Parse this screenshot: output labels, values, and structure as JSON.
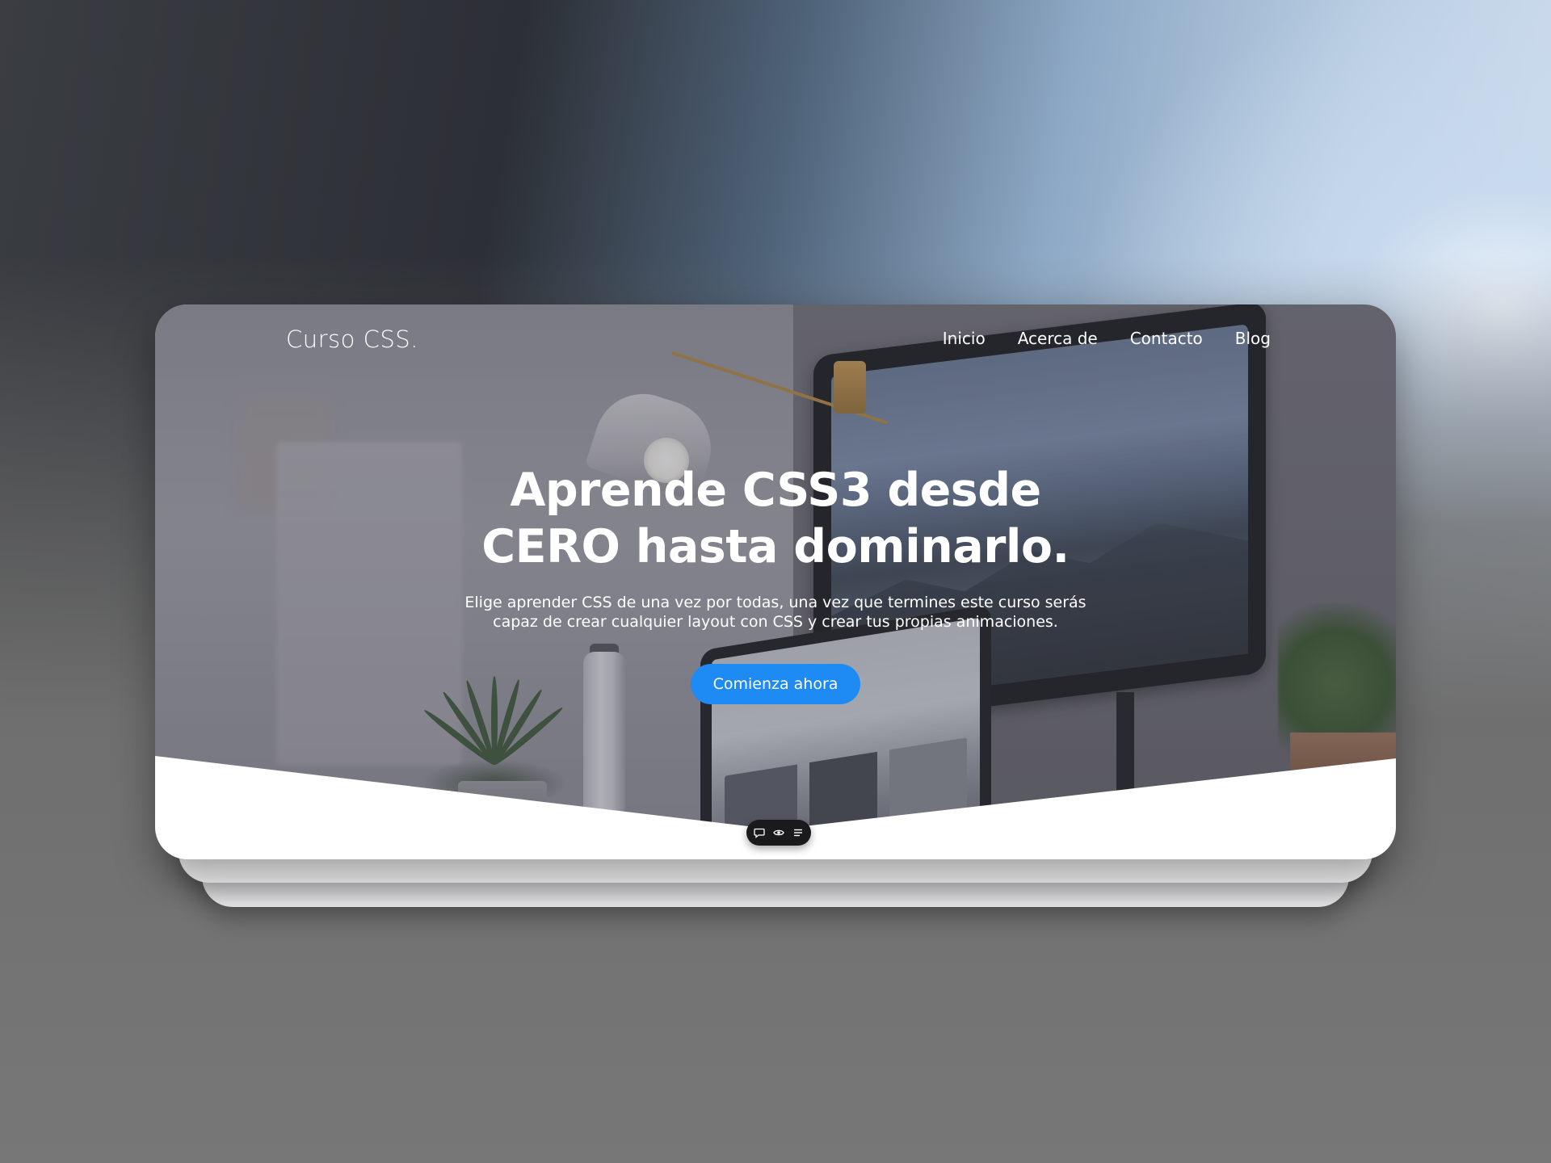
{
  "site": {
    "brand": "Curso CSS."
  },
  "nav": {
    "items": [
      {
        "label": "Inicio"
      },
      {
        "label": "Acerca de"
      },
      {
        "label": "Contacto"
      },
      {
        "label": "Blog"
      }
    ]
  },
  "hero": {
    "title_line1": "Aprende CSS3 desde",
    "title_line2": "CERO hasta dominarlo.",
    "subtitle_line1": "Elige aprender CSS de una vez por todas, una vez que termines este curso serás",
    "subtitle_line2": "capaz de crear cualquier layout con CSS y crear tus propias animaciones.",
    "cta_label": "Comienza ahora"
  },
  "toolbar": {
    "icons": [
      "comment-icon",
      "eye-icon",
      "list-icon"
    ]
  },
  "colors": {
    "accent": "#1e8af3",
    "text_on_hero": "#ffffff",
    "toolbar_bg": "#1a1a1c",
    "card_bg": "#ffffff"
  }
}
